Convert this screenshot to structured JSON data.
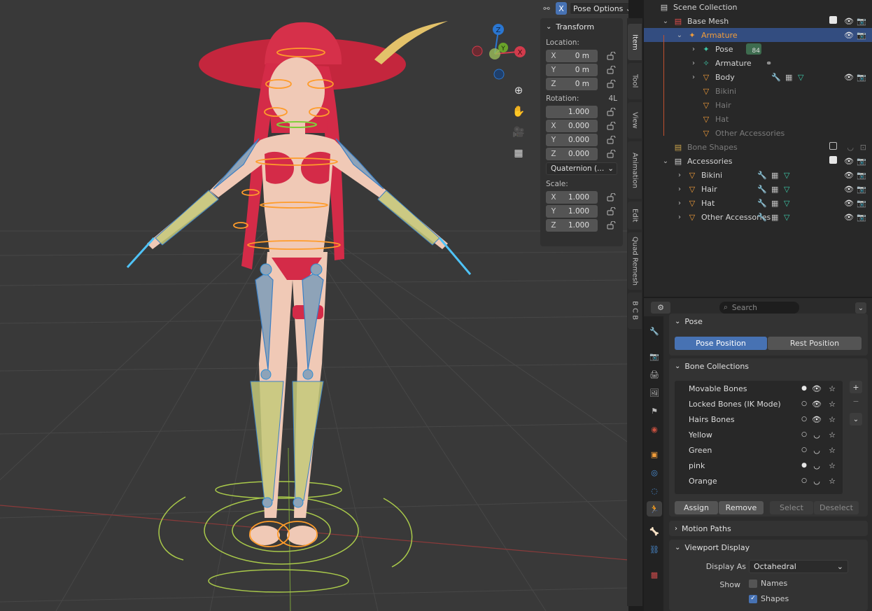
{
  "viewport": {
    "header": {
      "x_label": "X",
      "pose_options": "Pose Options"
    },
    "nav_gizmo": {
      "z": "Z",
      "y": "Y",
      "x": "X"
    },
    "transform": {
      "title": "Transform",
      "location_label": "Location:",
      "location": [
        {
          "axis": "X",
          "value": "0 m"
        },
        {
          "axis": "Y",
          "value": "0 m"
        },
        {
          "axis": "Z",
          "value": "0 m"
        }
      ],
      "rotation_label": "Rotation:",
      "rotation_mode_short": "4L",
      "rotation": [
        {
          "axis": "",
          "value": "1.000"
        },
        {
          "axis": "X",
          "value": "0.000"
        },
        {
          "axis": "Y",
          "value": "0.000"
        },
        {
          "axis": "Z",
          "value": "0.000"
        }
      ],
      "rotation_mode": "Quaternion (...",
      "scale_label": "Scale:",
      "scale": [
        {
          "axis": "X",
          "value": "1.000"
        },
        {
          "axis": "Y",
          "value": "1.000"
        },
        {
          "axis": "Z",
          "value": "1.000"
        }
      ]
    },
    "tabs": [
      "Item",
      "Tool",
      "View",
      "Animation",
      "Edit",
      "Quad Remesh",
      "B C B"
    ]
  },
  "outliner": {
    "rows": [
      {
        "name": "Scene Collection",
        "indent": 0,
        "icon": "scene-collection-icon"
      },
      {
        "name": "Base Mesh",
        "indent": 1,
        "icon": "collection-red-icon"
      },
      {
        "name": "Armature",
        "indent": 2,
        "icon": "armature-object-icon",
        "selected": true
      },
      {
        "name": "Pose",
        "indent": 3,
        "icon": "pose-icon",
        "badge": "84"
      },
      {
        "name": "Armature",
        "indent": 3,
        "icon": "armature-data-icon"
      },
      {
        "name": "Body",
        "indent": 3,
        "icon": "mesh-icon"
      },
      {
        "name": "Bikini",
        "indent": 3,
        "icon": "mesh-icon",
        "dim": true
      },
      {
        "name": "Hair",
        "indent": 3,
        "icon": "mesh-icon",
        "dim": true
      },
      {
        "name": "Hat",
        "indent": 3,
        "icon": "mesh-icon",
        "dim": true
      },
      {
        "name": "Other Accessories",
        "indent": 3,
        "icon": "mesh-icon",
        "dim": true
      },
      {
        "name": "Bone Shapes",
        "indent": 1,
        "icon": "collection-yellow-icon",
        "dim": true
      },
      {
        "name": "Accessories",
        "indent": 1,
        "icon": "collection-icon"
      },
      {
        "name": "Bikini",
        "indent": 2,
        "icon": "mesh-icon"
      },
      {
        "name": "Hair",
        "indent": 2,
        "icon": "mesh-icon"
      },
      {
        "name": "Hat",
        "indent": 2,
        "icon": "mesh-icon"
      },
      {
        "name": "Other Accessories",
        "indent": 2,
        "icon": "mesh-icon"
      }
    ]
  },
  "properties": {
    "search_placeholder": "Search",
    "pose": {
      "title": "Pose",
      "pose_position": "Pose Position",
      "rest_position": "Rest Position"
    },
    "bone_collections": {
      "title": "Bone Collections",
      "items": [
        {
          "name": "Movable Bones",
          "active": true,
          "visible": true
        },
        {
          "name": "Locked Bones (IK Mode)",
          "active": false,
          "visible": true
        },
        {
          "name": "Hairs Bones",
          "active": false,
          "visible": true
        },
        {
          "name": "Yellow",
          "active": false,
          "visible": false
        },
        {
          "name": "Green",
          "active": false,
          "visible": false
        },
        {
          "name": "pink",
          "active": true,
          "visible": false
        },
        {
          "name": "Orange",
          "active": false,
          "visible": false
        }
      ],
      "assign": "Assign",
      "remove": "Remove",
      "select": "Select",
      "deselect": "Deselect"
    },
    "motion_paths": {
      "title": "Motion Paths"
    },
    "viewport_display": {
      "title": "Viewport Display",
      "display_as_label": "Display As",
      "display_as_value": "Octahedral",
      "show_label": "Show",
      "names_label": "Names",
      "names_checked": false,
      "shapes_label": "Shapes",
      "shapes_checked": true
    }
  },
  "colors": {
    "accent": "#4772b3",
    "selection": "#334d80",
    "armature_orange": "#ff9c2a"
  }
}
